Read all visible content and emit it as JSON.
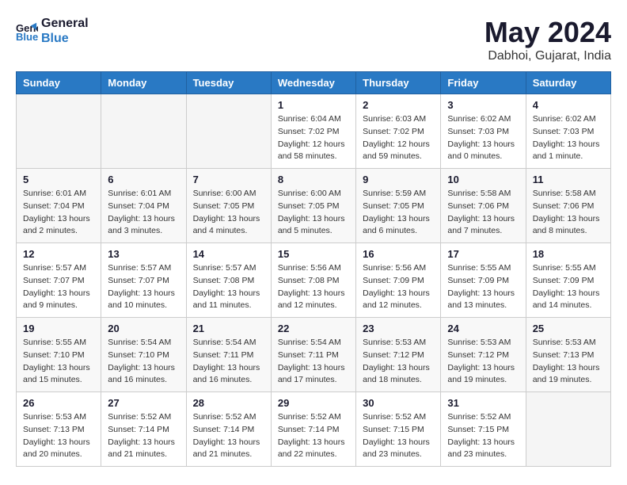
{
  "header": {
    "logo_line1": "General",
    "logo_line2": "Blue",
    "title": "May 2024",
    "subtitle": "Dabhoi, Gujarat, India"
  },
  "weekdays": [
    "Sunday",
    "Monday",
    "Tuesday",
    "Wednesday",
    "Thursday",
    "Friday",
    "Saturday"
  ],
  "weeks": [
    [
      {
        "day": "",
        "info": ""
      },
      {
        "day": "",
        "info": ""
      },
      {
        "day": "",
        "info": ""
      },
      {
        "day": "1",
        "info": "Sunrise: 6:04 AM\nSunset: 7:02 PM\nDaylight: 12 hours\nand 58 minutes."
      },
      {
        "day": "2",
        "info": "Sunrise: 6:03 AM\nSunset: 7:02 PM\nDaylight: 12 hours\nand 59 minutes."
      },
      {
        "day": "3",
        "info": "Sunrise: 6:02 AM\nSunset: 7:03 PM\nDaylight: 13 hours\nand 0 minutes."
      },
      {
        "day": "4",
        "info": "Sunrise: 6:02 AM\nSunset: 7:03 PM\nDaylight: 13 hours\nand 1 minute."
      }
    ],
    [
      {
        "day": "5",
        "info": "Sunrise: 6:01 AM\nSunset: 7:04 PM\nDaylight: 13 hours\nand 2 minutes."
      },
      {
        "day": "6",
        "info": "Sunrise: 6:01 AM\nSunset: 7:04 PM\nDaylight: 13 hours\nand 3 minutes."
      },
      {
        "day": "7",
        "info": "Sunrise: 6:00 AM\nSunset: 7:05 PM\nDaylight: 13 hours\nand 4 minutes."
      },
      {
        "day": "8",
        "info": "Sunrise: 6:00 AM\nSunset: 7:05 PM\nDaylight: 13 hours\nand 5 minutes."
      },
      {
        "day": "9",
        "info": "Sunrise: 5:59 AM\nSunset: 7:05 PM\nDaylight: 13 hours\nand 6 minutes."
      },
      {
        "day": "10",
        "info": "Sunrise: 5:58 AM\nSunset: 7:06 PM\nDaylight: 13 hours\nand 7 minutes."
      },
      {
        "day": "11",
        "info": "Sunrise: 5:58 AM\nSunset: 7:06 PM\nDaylight: 13 hours\nand 8 minutes."
      }
    ],
    [
      {
        "day": "12",
        "info": "Sunrise: 5:57 AM\nSunset: 7:07 PM\nDaylight: 13 hours\nand 9 minutes."
      },
      {
        "day": "13",
        "info": "Sunrise: 5:57 AM\nSunset: 7:07 PM\nDaylight: 13 hours\nand 10 minutes."
      },
      {
        "day": "14",
        "info": "Sunrise: 5:57 AM\nSunset: 7:08 PM\nDaylight: 13 hours\nand 11 minutes."
      },
      {
        "day": "15",
        "info": "Sunrise: 5:56 AM\nSunset: 7:08 PM\nDaylight: 13 hours\nand 12 minutes."
      },
      {
        "day": "16",
        "info": "Sunrise: 5:56 AM\nSunset: 7:09 PM\nDaylight: 13 hours\nand 12 minutes."
      },
      {
        "day": "17",
        "info": "Sunrise: 5:55 AM\nSunset: 7:09 PM\nDaylight: 13 hours\nand 13 minutes."
      },
      {
        "day": "18",
        "info": "Sunrise: 5:55 AM\nSunset: 7:09 PM\nDaylight: 13 hours\nand 14 minutes."
      }
    ],
    [
      {
        "day": "19",
        "info": "Sunrise: 5:55 AM\nSunset: 7:10 PM\nDaylight: 13 hours\nand 15 minutes."
      },
      {
        "day": "20",
        "info": "Sunrise: 5:54 AM\nSunset: 7:10 PM\nDaylight: 13 hours\nand 16 minutes."
      },
      {
        "day": "21",
        "info": "Sunrise: 5:54 AM\nSunset: 7:11 PM\nDaylight: 13 hours\nand 16 minutes."
      },
      {
        "day": "22",
        "info": "Sunrise: 5:54 AM\nSunset: 7:11 PM\nDaylight: 13 hours\nand 17 minutes."
      },
      {
        "day": "23",
        "info": "Sunrise: 5:53 AM\nSunset: 7:12 PM\nDaylight: 13 hours\nand 18 minutes."
      },
      {
        "day": "24",
        "info": "Sunrise: 5:53 AM\nSunset: 7:12 PM\nDaylight: 13 hours\nand 19 minutes."
      },
      {
        "day": "25",
        "info": "Sunrise: 5:53 AM\nSunset: 7:13 PM\nDaylight: 13 hours\nand 19 minutes."
      }
    ],
    [
      {
        "day": "26",
        "info": "Sunrise: 5:53 AM\nSunset: 7:13 PM\nDaylight: 13 hours\nand 20 minutes."
      },
      {
        "day": "27",
        "info": "Sunrise: 5:52 AM\nSunset: 7:14 PM\nDaylight: 13 hours\nand 21 minutes."
      },
      {
        "day": "28",
        "info": "Sunrise: 5:52 AM\nSunset: 7:14 PM\nDaylight: 13 hours\nand 21 minutes."
      },
      {
        "day": "29",
        "info": "Sunrise: 5:52 AM\nSunset: 7:14 PM\nDaylight: 13 hours\nand 22 minutes."
      },
      {
        "day": "30",
        "info": "Sunrise: 5:52 AM\nSunset: 7:15 PM\nDaylight: 13 hours\nand 23 minutes."
      },
      {
        "day": "31",
        "info": "Sunrise: 5:52 AM\nSunset: 7:15 PM\nDaylight: 13 hours\nand 23 minutes."
      },
      {
        "day": "",
        "info": ""
      }
    ]
  ]
}
